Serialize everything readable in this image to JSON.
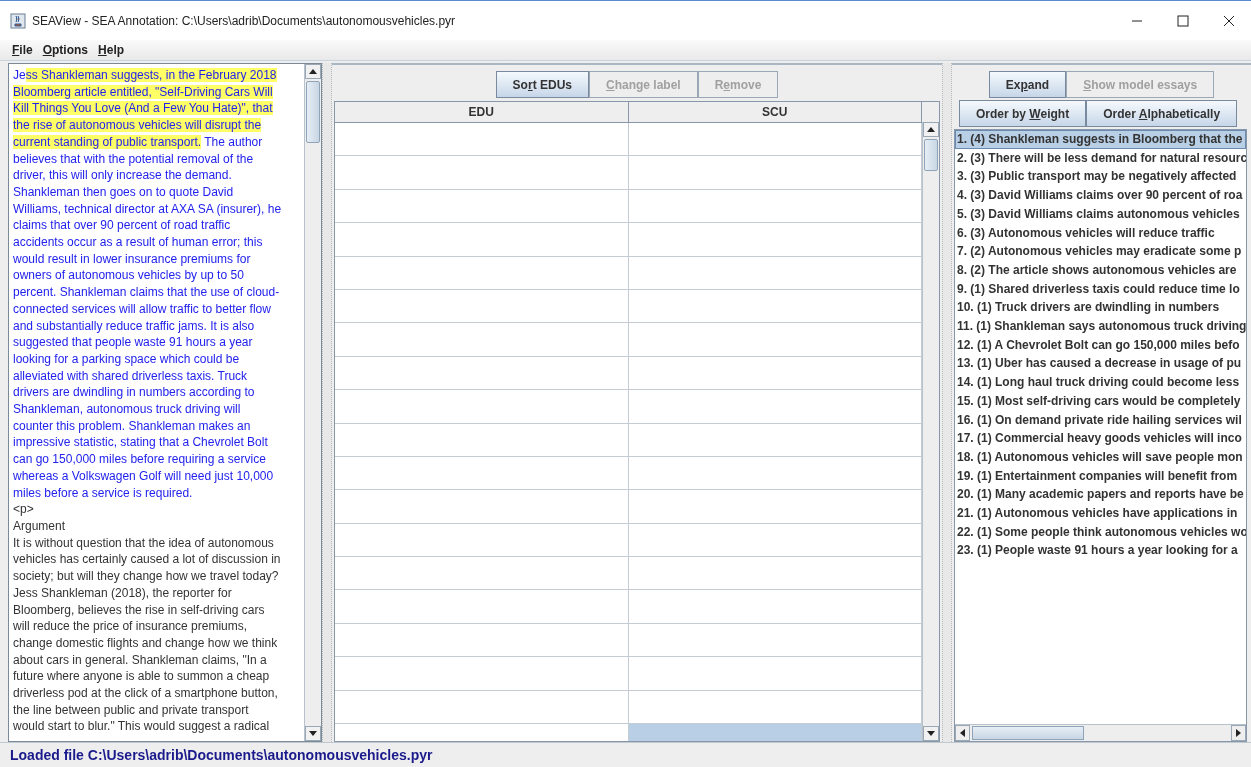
{
  "window": {
    "title": "SEAView - SEA Annotation: C:\\Users\\adrib\\Documents\\autonomousvehicles.pyr"
  },
  "menu": [
    {
      "label": {
        "key": "F",
        "post": "ile"
      }
    },
    {
      "label": {
        "key": "O",
        "post": "ptions"
      }
    },
    {
      "label": {
        "key": "H",
        "post": "elp"
      }
    }
  ],
  "essay": {
    "lines": [
      [
        {
          "kind": "edu",
          "text": "Je"
        },
        {
          "kind": "highlight",
          "text": "ss Shankleman suggests, in the February 2018"
        }
      ],
      [
        {
          "kind": "highlight",
          "text": "Bloomberg article entitled, \"Self-Driving Cars Will"
        }
      ],
      [
        {
          "kind": "highlight",
          "text": "Kill Things You Love (And a Few You Hate)\", that"
        }
      ],
      [
        {
          "kind": "highlight",
          "text": "the rise of autonomous vehicles will disrupt the"
        }
      ],
      [
        {
          "kind": "highlight",
          "text": "current standing of public transport."
        },
        {
          "kind": "edu",
          "text": " The author"
        }
      ],
      [
        {
          "kind": "edu",
          "text": "believes that with the potential removal of the"
        }
      ],
      [
        {
          "kind": "edu",
          "text": "driver, this will only increase the demand."
        }
      ],
      [
        {
          "kind": "edu",
          "text": "Shankleman then goes on to quote David"
        }
      ],
      [
        {
          "kind": "edu",
          "text": "Williams, technical director at AXA SA (insurer), he"
        }
      ],
      [
        {
          "kind": "edu",
          "text": "claims that over 90 percent of road traffic"
        }
      ],
      [
        {
          "kind": "edu",
          "text": "accidents occur as a result of human error; this"
        }
      ],
      [
        {
          "kind": "edu",
          "text": "would result in lower insurance premiums for"
        }
      ],
      [
        {
          "kind": "edu",
          "text": "owners of autonomous vehicles by up to 50"
        }
      ],
      [
        {
          "kind": "edu",
          "text": "percent. Shankleman claims that the use of cloud-"
        }
      ],
      [
        {
          "kind": "edu",
          "text": "connected services will allow traffic to better flow"
        }
      ],
      [
        {
          "kind": "edu",
          "text": "and substantially reduce traffic jams. It is also"
        }
      ],
      [
        {
          "kind": "edu",
          "text": "suggested that people waste 91 hours a year"
        }
      ],
      [
        {
          "kind": "edu",
          "text": "looking for a parking space which could be"
        }
      ],
      [
        {
          "kind": "edu",
          "text": "alleviated with shared driverless taxis. Truck"
        }
      ],
      [
        {
          "kind": "edu",
          "text": "drivers are dwindling in numbers according to"
        }
      ],
      [
        {
          "kind": "edu",
          "text": "Shankleman, autonomous truck driving will"
        }
      ],
      [
        {
          "kind": "edu",
          "text": "counter this problem. Shankleman makes an"
        }
      ],
      [
        {
          "kind": "edu",
          "text": "impressive statistic, stating that a Chevrolet Bolt"
        }
      ],
      [
        {
          "kind": "edu",
          "text": "can go 150,000 miles before requiring a service"
        }
      ],
      [
        {
          "kind": "edu",
          "text": "whereas a Volkswagen Golf will need just 10,000"
        }
      ],
      [
        {
          "kind": "edu",
          "text": "miles before a service is required."
        }
      ],
      [
        {
          "kind": "plain",
          "text": "<p>"
        }
      ],
      [
        {
          "kind": "plain",
          "text": "Argument"
        }
      ],
      [
        {
          "kind": "plain",
          "text": "It is without question that the idea of autonomous"
        }
      ],
      [
        {
          "kind": "plain",
          "text": "vehicles has certainly caused a lot of discussion in"
        }
      ],
      [
        {
          "kind": "plain",
          "text": "society; but will they change how we travel today?"
        }
      ],
      [
        {
          "kind": "plain",
          "text": "Jess Shankleman (2018), the reporter for"
        }
      ],
      [
        {
          "kind": "plain",
          "text": "Bloomberg, believes the rise in self-driving cars"
        }
      ],
      [
        {
          "kind": "plain",
          "text": "will reduce the price of insurance premiums,"
        }
      ],
      [
        {
          "kind": "plain",
          "text": "change domestic flights and change how we think"
        }
      ],
      [
        {
          "kind": "plain",
          "text": "about cars in general. Shankleman claims, \"In a"
        }
      ],
      [
        {
          "kind": "plain",
          "text": "future where anyone is able to summon a cheap"
        }
      ],
      [
        {
          "kind": "plain",
          "text": "driverless pod at the click of a smartphone button,"
        }
      ],
      [
        {
          "kind": "plain",
          "text": "the line between public and private transport"
        }
      ],
      [
        {
          "kind": "plain",
          "text": "would start to blur.\" This would suggest a radical"
        }
      ]
    ]
  },
  "edu_panel": {
    "buttons": [
      {
        "label": {
          "pre": "So",
          "key": "r",
          "post": "t EDUs"
        },
        "disabled": false
      },
      {
        "label": {
          "key": "C",
          "post": "hange label"
        },
        "disabled": true
      },
      {
        "label": {
          "pre": "R",
          "key": "e",
          "post": "move"
        },
        "disabled": true
      }
    ],
    "table": {
      "columns": [
        "EDU",
        "SCU"
      ],
      "rows": [
        {
          "selected": false
        },
        {
          "selected": false
        },
        {
          "selected": false
        },
        {
          "selected": false
        },
        {
          "selected": false
        },
        {
          "selected": false
        },
        {
          "selected": false
        },
        {
          "selected": false
        },
        {
          "selected": false
        },
        {
          "selected": false
        },
        {
          "selected": false
        },
        {
          "selected": false
        },
        {
          "selected": false
        },
        {
          "selected": false
        },
        {
          "selected": false
        },
        {
          "selected": false
        },
        {
          "selected": false
        },
        {
          "selected": false
        },
        {
          "selected": true
        }
      ]
    }
  },
  "scu_panel": {
    "buttons": [
      {
        "label": {
          "pre": "Ex",
          "key": "p",
          "post": "and"
        },
        "disabled": false
      },
      {
        "label": {
          "key": "S",
          "post": "how model essays"
        },
        "disabled": true
      }
    ],
    "order_buttons": [
      {
        "label": {
          "pre": "Order by ",
          "key": "W",
          "post": "eight"
        }
      },
      {
        "label": {
          "pre": "Order ",
          "key": "A",
          "post": "lphabetically"
        }
      }
    ],
    "items": [
      {
        "text": "1. (4) Shankleman suggests in Bloomberg that the",
        "selected": true
      },
      {
        "text": "2. (3) There will be less demand for natural resourc",
        "selected": false
      },
      {
        "text": "3. (3) Public transport may be negatively affected",
        "selected": false
      },
      {
        "text": "4. (3) David Williams claims over 90 percent of roa",
        "selected": false
      },
      {
        "text": "5. (3) David Williams claims autonomous vehicles",
        "selected": false
      },
      {
        "text": "6. (3) Autonomous vehicles will reduce traffic",
        "selected": false
      },
      {
        "text": "7. (2) Autonomous vehicles may eradicate some p",
        "selected": false
      },
      {
        "text": "8. (2) The article shows autonomous vehicles are",
        "selected": false
      },
      {
        "text": "9. (1) Shared driverless taxis could reduce time lo",
        "selected": false
      },
      {
        "text": "10. (1) Truck drivers are dwindling in numbers",
        "selected": false
      },
      {
        "text": "11. (1) Shankleman says autonomous truck driving",
        "selected": false
      },
      {
        "text": "12. (1) A Chevrolet Bolt can go 150,000 miles befo",
        "selected": false
      },
      {
        "text": "13. (1) Uber has caused a decrease in usage of pu",
        "selected": false
      },
      {
        "text": "14. (1) Long haul truck driving could become less",
        "selected": false
      },
      {
        "text": "15. (1) Most self-driving cars would be completely",
        "selected": false
      },
      {
        "text": "16. (1) On demand private ride hailing services wil",
        "selected": false
      },
      {
        "text": "17. (1) Commercial heavy goods vehicles will inco",
        "selected": false
      },
      {
        "text": "18. (1) Autonomous vehicles will save people mon",
        "selected": false
      },
      {
        "text": "19. (1) Entertainment companies will benefit from",
        "selected": false
      },
      {
        "text": "20. (1) Many academic papers and reports have be",
        "selected": false
      },
      {
        "text": "21. (1) Autonomous vehicles have applications in",
        "selected": false
      },
      {
        "text": "22. (1) Some people think autonomous vehicles wo",
        "selected": false
      },
      {
        "text": "23. (1) People waste 91 hours a year looking for a",
        "selected": false
      }
    ]
  },
  "status_bar": "Loaded file C:\\Users\\adrib\\Documents\\autonomousvehicles.pyr"
}
